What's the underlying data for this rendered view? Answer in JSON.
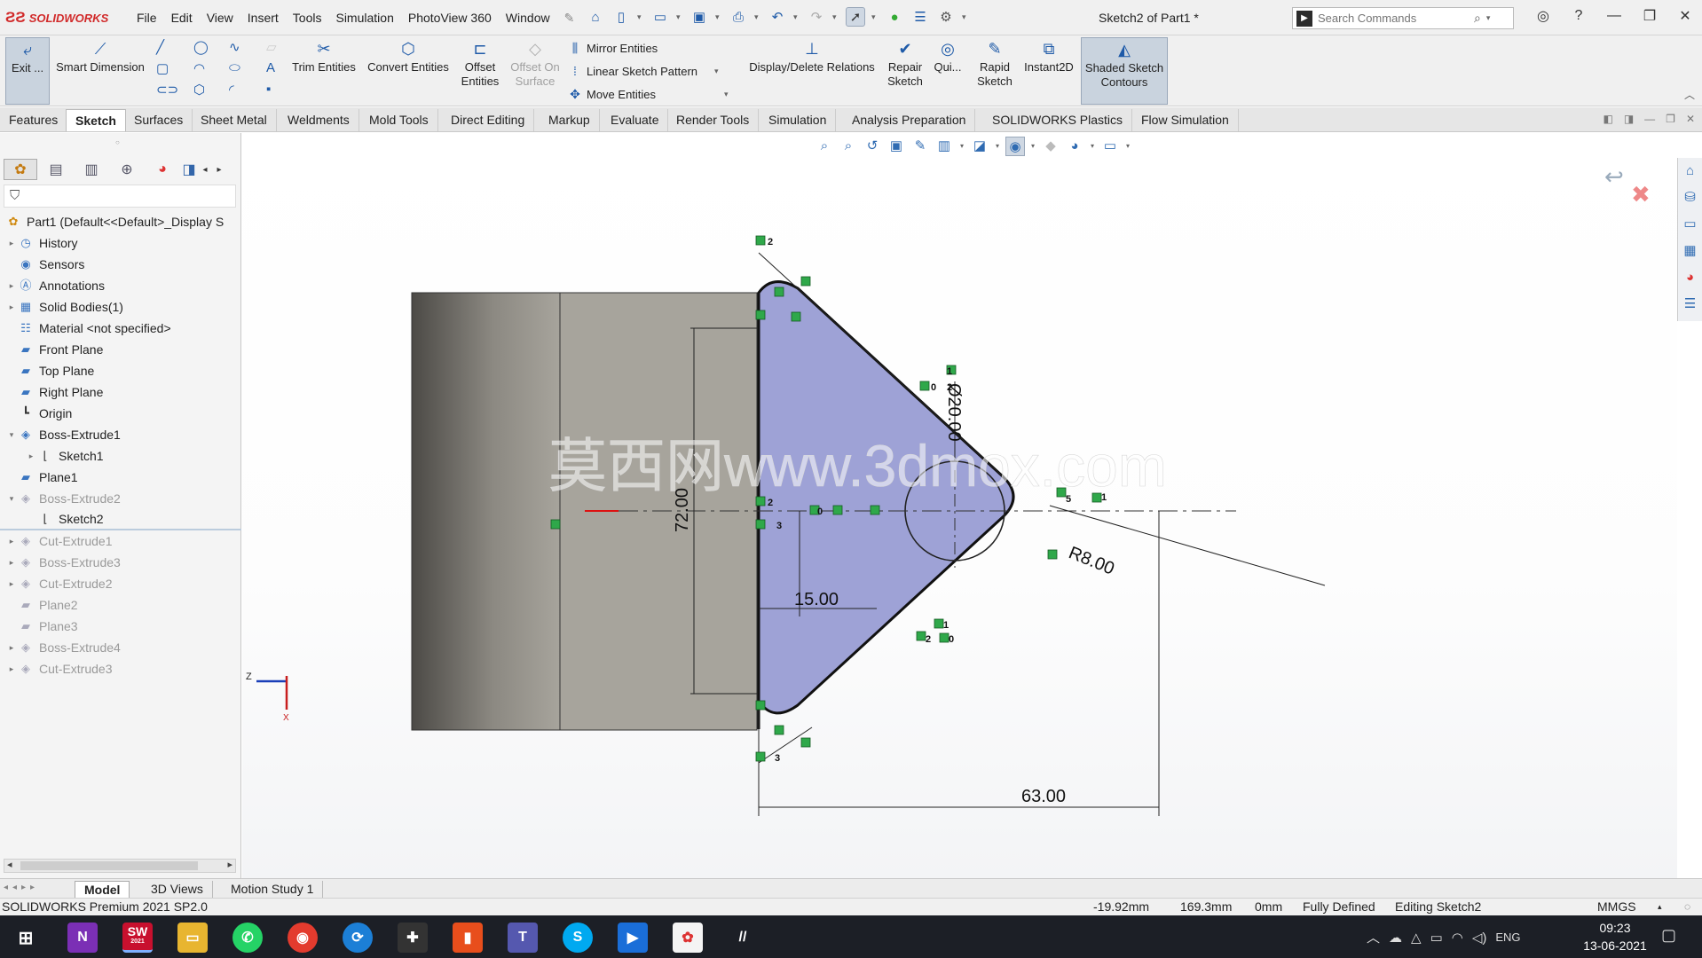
{
  "app": {
    "brand_logo": "SOLIDWORKS",
    "doc_title": "Sketch2 of Part1 *"
  },
  "menu": [
    "File",
    "Edit",
    "View",
    "Insert",
    "Tools",
    "Simulation",
    "PhotoView 360",
    "Window"
  ],
  "search": {
    "placeholder": "Search Commands"
  },
  "ribbon": {
    "exit": "Exit ...",
    "smart_dimension": "Smart Dimension",
    "trim": "Trim Entities",
    "convert": "Convert Entities",
    "offset": "Offset Entities",
    "offset_surface": "Offset On Surface",
    "mirror": "Mirror Entities",
    "linear_pattern": "Linear Sketch Pattern",
    "move": "Move Entities",
    "display_relations": "Display/Delete Relations",
    "repair": "Repair Sketch",
    "quick": "Qui...",
    "rapid": "Rapid Sketch",
    "instant2d": "Instant2D",
    "shaded": "Shaded Sketch Contours"
  },
  "tabs": [
    "Features",
    "Sketch",
    "Surfaces",
    "Sheet Metal",
    "Weldments",
    "Mold Tools",
    "Direct Editing",
    "Markup",
    "Evaluate",
    "Render Tools",
    "Simulation",
    "Analysis Preparation",
    "SOLIDWORKS Plastics",
    "Flow Simulation"
  ],
  "active_tab": "Sketch",
  "tree": {
    "root": "Part1  (Default<<Default>_Display S",
    "items": [
      {
        "label": "History",
        "icon": "history-icon"
      },
      {
        "label": "Sensors",
        "icon": "sensor-icon"
      },
      {
        "label": "Annotations",
        "icon": "annotations-icon"
      },
      {
        "label": "Solid Bodies(1)",
        "icon": "solid-bodies-icon"
      },
      {
        "label": "Material <not specified>",
        "icon": "material-icon"
      },
      {
        "label": "Front Plane",
        "icon": "plane-icon"
      },
      {
        "label": "Top Plane",
        "icon": "plane-icon"
      },
      {
        "label": "Right Plane",
        "icon": "plane-icon"
      },
      {
        "label": "Origin",
        "icon": "origin-icon"
      },
      {
        "label": "Boss-Extrude1",
        "icon": "extrude-icon"
      },
      {
        "label": "Sketch1",
        "icon": "sketch-icon"
      },
      {
        "label": "Plane1",
        "icon": "plane-icon"
      },
      {
        "label": "Boss-Extrude2",
        "icon": "extrude-icon"
      },
      {
        "label": "Sketch2",
        "icon": "sketch-icon"
      },
      {
        "label": "Cut-Extrude1",
        "icon": "cut-icon"
      },
      {
        "label": "Boss-Extrude3",
        "icon": "extrude-icon"
      },
      {
        "label": "Cut-Extrude2",
        "icon": "cut-icon"
      },
      {
        "label": "Plane2",
        "icon": "plane-icon"
      },
      {
        "label": "Plane3",
        "icon": "plane-icon"
      },
      {
        "label": "Boss-Extrude4",
        "icon": "extrude-icon"
      },
      {
        "label": "Cut-Extrude3",
        "icon": "cut-icon"
      }
    ]
  },
  "sketch": {
    "dims": {
      "diameter": "Ø20.00",
      "height": "72.00",
      "offset": "15.00",
      "radius": "R8.00",
      "length": "63.00"
    },
    "watermark": "莫西网www.3dmox.com",
    "relation_numbers": {
      "top": "2",
      "bottom": "3",
      "tip": "1",
      "tip2": "5",
      "left": "2",
      "left2": "3",
      "upper1": "1",
      "upper2": "2",
      "upper0": "0",
      "lower1": "1",
      "lower0": "0",
      "lower2": "2",
      "c0": "0"
    },
    "axis_label": "Z",
    "triad_x_label": "X",
    "fill_color": "#9ea2d6",
    "body_color": "#a7a49c"
  },
  "bottom_tabs": [
    "Model",
    "3D Views",
    "Motion Study 1"
  ],
  "status": {
    "product": "SOLIDWORKS Premium 2021 SP2.0",
    "x": "-19.92mm",
    "y": "169.3mm",
    "z": "0mm",
    "state": "Fully Defined",
    "editing": "Editing Sketch2",
    "units": "MMGS"
  },
  "taskbar": {
    "start_icon": "windows-start-icon",
    "onenote_letter": "N",
    "sw_letter": "SW",
    "sw_year": "2021",
    "lang": "ENG",
    "time": "09:23",
    "date": "13-06-2021"
  }
}
